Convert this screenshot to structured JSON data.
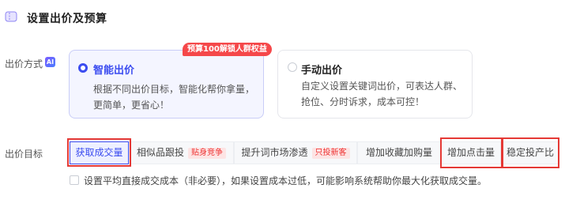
{
  "header": {
    "title": "设置出价及预算",
    "icon": "ticket-icon"
  },
  "bid_method": {
    "label": "出价方式",
    "ai_badge": "AI",
    "promo_tag": "预算100解锁人群权益",
    "options": [
      {
        "title": "智能出价",
        "desc_line1": "根据不同出价目标，智能化帮你拿量，",
        "desc_line2": "更简单，更省心！",
        "selected": true
      },
      {
        "title": "手动出价",
        "desc_line1": "自定义设置关键词出价，可表达人群、",
        "desc_line2": "抢位、分时诉求，成本可控！",
        "selected": false
      }
    ]
  },
  "bid_goal": {
    "label": "出价目标",
    "tabs": [
      {
        "label": "获取成交量",
        "tag": "",
        "selected": true
      },
      {
        "label": "相似品跟投",
        "tag": "贴身竞争",
        "selected": false
      },
      {
        "label": "提升词市场渗透",
        "tag": "只投新客",
        "selected": false
      },
      {
        "label": "增加收藏加购量",
        "tag": "",
        "selected": false
      },
      {
        "label": "增加点击量",
        "tag": "",
        "selected": false
      },
      {
        "label": "稳定投产比",
        "tag": "",
        "selected": false
      }
    ]
  },
  "avg_cost_option": {
    "label": "设置平均直接成交成本（非必要），如果设置成本过低，可能影响系统帮助你最大化获取成交量。",
    "checked": false
  },
  "colors": {
    "accent": "#3b4cf0",
    "highlight": "#e53935",
    "promo": "#f5484a"
  }
}
